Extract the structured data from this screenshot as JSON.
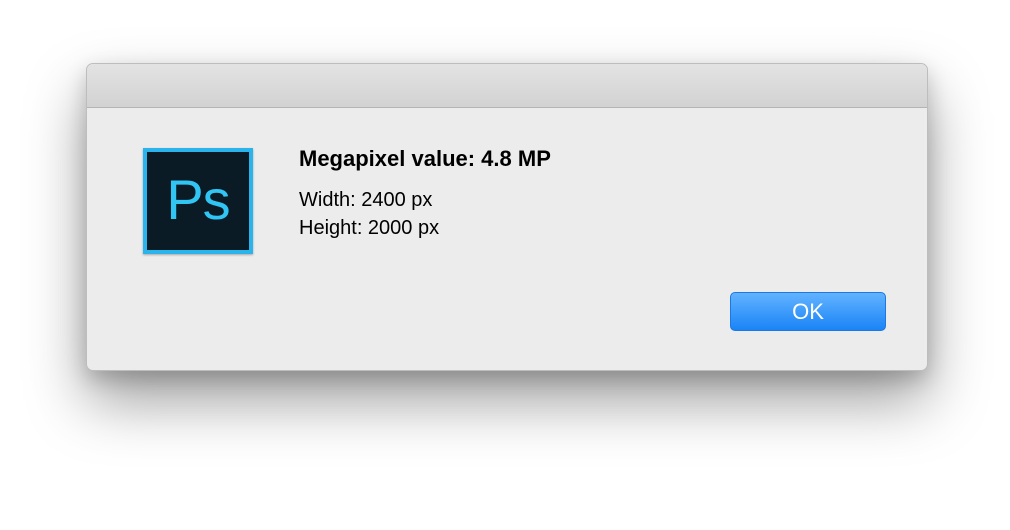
{
  "dialog": {
    "icon": {
      "name": "photoshop-app-icon",
      "text": "Ps",
      "bg": "#0a1b26",
      "accent": "#2bb3ec"
    },
    "title": "Megapixel value: 4.8 MP",
    "lines": [
      "Width: 2400 px",
      "Height: 2000 px"
    ],
    "ok_label": "OK"
  }
}
